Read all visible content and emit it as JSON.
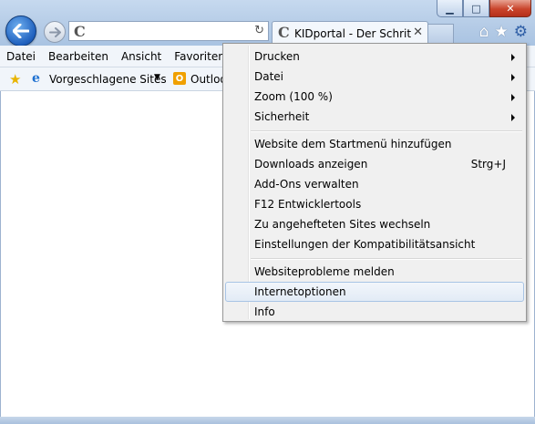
{
  "window": {
    "minimize_label": "▁",
    "maximize_label": "□",
    "close_label": "✕"
  },
  "address_bar": {
    "favicon": "C",
    "refresh_icon": "refresh-icon",
    "value": ""
  },
  "tab": {
    "favicon": "C",
    "title": "KIDportal - Der Schritt ...",
    "close_label": "✕"
  },
  "menubar": {
    "items": [
      "Datei",
      "Bearbeiten",
      "Ansicht",
      "Favoriten"
    ]
  },
  "favorites_bar": {
    "suggested_sites": "Vorgeschlagene Sites",
    "outlook": "Outlook"
  },
  "tools_menu": {
    "items": [
      {
        "label": "Drucken",
        "submenu": true
      },
      {
        "label": "Datei",
        "submenu": true
      },
      {
        "label": "Zoom (100 %)",
        "submenu": true
      },
      {
        "label": "Sicherheit",
        "submenu": true
      },
      {
        "label": "Website dem Startmenü hinzufügen"
      },
      {
        "label": "Downloads anzeigen",
        "shortcut": "Strg+J"
      },
      {
        "label": "Add-Ons verwalten"
      },
      {
        "label": "F12 Entwicklertools"
      },
      {
        "label": "Zu angehefteten Sites wechseln"
      },
      {
        "label": "Einstellungen der Kompatibilitätsansicht"
      },
      {
        "label": "Websiteprobleme melden"
      },
      {
        "label": "Internetoptionen",
        "highlighted": true
      },
      {
        "label": "Info"
      }
    ]
  },
  "colors": {
    "frame": "#b4cbe6",
    "menu_bg": "#f0f0f0",
    "highlight": "#e2ebf6",
    "back_button": "#1e5fbd"
  }
}
